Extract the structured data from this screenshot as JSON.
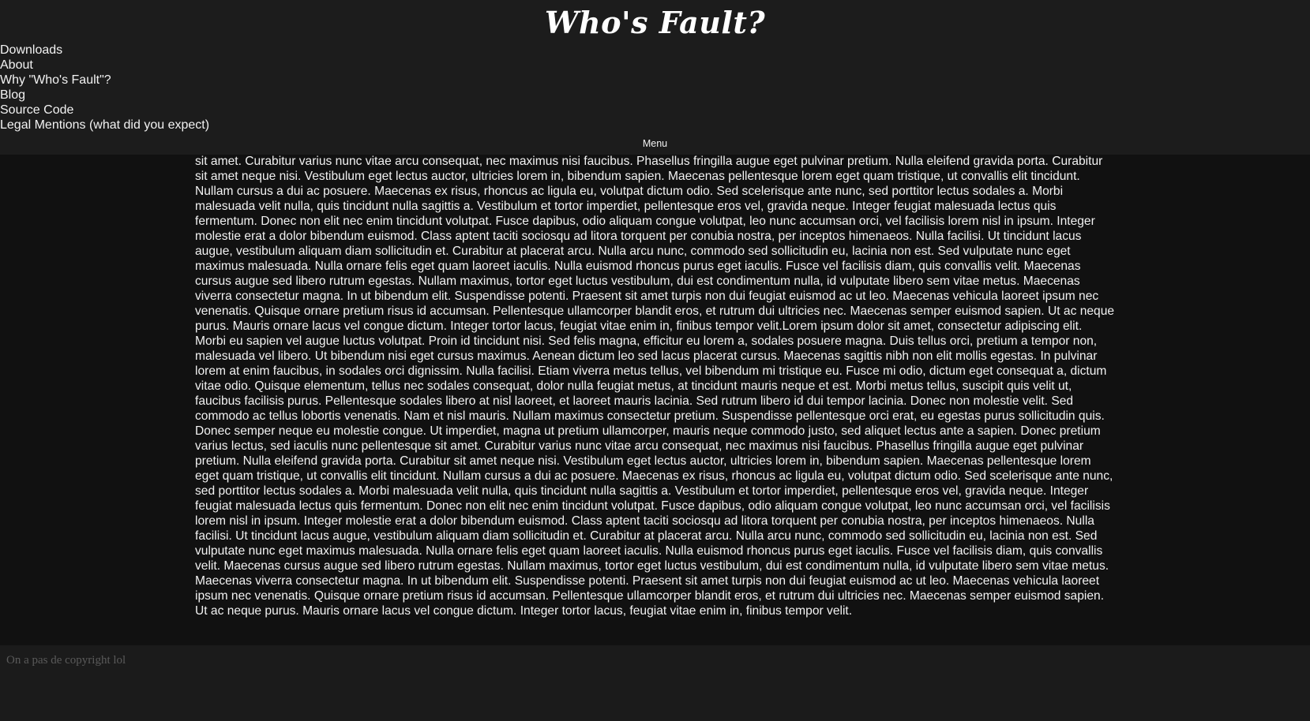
{
  "site": {
    "title": "Who's Fault?"
  },
  "nav": {
    "items": [
      {
        "label": "Downloads"
      },
      {
        "label": "About"
      },
      {
        "label": "Why \"Who's Fault\"?"
      },
      {
        "label": "Blog"
      },
      {
        "label": "Source Code"
      },
      {
        "label": "Legal Mentions (what did you expect)"
      }
    ],
    "menu_label": "Menu"
  },
  "main": {
    "body_text": "Ut imperdiet, magna ut pretium ullamcorper, mauris neque commodo justo, sed aliquet lectus ante a sapien. Donec pretium varius lectus, sed iaculis nunc pellentesque sit amet. Curabitur varius nunc vitae arcu consequat, nec maximus nisi faucibus. Phasellus fringilla augue eget pulvinar pretium. Nulla eleifend gravida porta. Curabitur sit amet neque nisi. Vestibulum eget lectus auctor, ultricies lorem in, bibendum sapien. Maecenas pellentesque lorem eget quam tristique, ut convallis elit tincidunt. Nullam cursus a dui ac posuere. Maecenas ex risus, rhoncus ac ligula eu, volutpat dictum odio. Sed scelerisque ante nunc, sed porttitor lectus sodales a. Morbi malesuada velit nulla, quis tincidunt nulla sagittis a. Vestibulum et tortor imperdiet, pellentesque eros vel, gravida neque. Integer feugiat malesuada lectus quis fermentum. Donec non elit nec enim tincidunt volutpat. Fusce dapibus, odio aliquam congue volutpat, leo nunc accumsan orci, vel facilisis lorem nisl in ipsum. Integer molestie erat a dolor bibendum euismod. Class aptent taciti sociosqu ad litora torquent per conubia nostra, per inceptos himenaeos. Nulla facilisi. Ut tincidunt lacus augue, vestibulum aliquam diam sollicitudin et. Curabitur at placerat arcu. Nulla arcu nunc, commodo sed sollicitudin eu, lacinia non est. Sed vulputate nunc eget maximus malesuada. Nulla ornare felis eget quam laoreet iaculis. Nulla euismod rhoncus purus eget iaculis. Fusce vel facilisis diam, quis convallis velit. Maecenas cursus augue sed libero rutrum egestas. Nullam maximus, tortor eget luctus vestibulum, dui est condimentum nulla, id vulputate libero sem vitae metus. Maecenas viverra consectetur magna. In ut bibendum elit. Suspendisse potenti. Praesent sit amet turpis non dui feugiat euismod ac ut leo. Maecenas vehicula laoreet ipsum nec venenatis. Quisque ornare pretium risus id accumsan. Pellentesque ullamcorper blandit eros, et rutrum dui ultricies nec. Maecenas semper euismod sapien. Ut ac neque purus. Mauris ornare lacus vel congue dictum. Integer tortor lacus, feugiat vitae enim in, finibus tempor velit.Lorem ipsum dolor sit amet, consectetur adipiscing elit. Morbi eu sapien vel augue luctus volutpat. Proin id tincidunt nisi. Sed felis magna, efficitur eu lorem a, sodales posuere magna. Duis tellus orci, pretium a tempor non, malesuada vel libero. Ut bibendum nisi eget cursus maximus. Aenean dictum leo sed lacus placerat cursus. Maecenas sagittis nibh non elit mollis egestas. In pulvinar lorem at enim faucibus, in sodales orci dignissim. Nulla facilisi. Etiam viverra metus tellus, vel bibendum mi tristique eu. Fusce mi odio, dictum eget consequat a, dictum vitae odio. Quisque elementum, tellus nec sodales consequat, dolor nulla feugiat metus, at tincidunt mauris neque et est. Morbi metus tellus, suscipit quis velit ut, faucibus facilisis purus. Pellentesque sodales libero at nisl laoreet, et laoreet mauris lacinia. Sed rutrum libero id dui tempor lacinia. Donec non molestie velit. Sed commodo ac tellus lobortis venenatis. Nam et nisl mauris. Nullam maximus consectetur pretium. Suspendisse pellentesque orci erat, eu egestas purus sollicitudin quis. Donec semper neque eu molestie congue. Ut imperdiet, magna ut pretium ullamcorper, mauris neque commodo justo, sed aliquet lectus ante a sapien. Donec pretium varius lectus, sed iaculis nunc pellentesque sit amet. Curabitur varius nunc vitae arcu consequat, nec maximus nisi faucibus. Phasellus fringilla augue eget pulvinar pretium. Nulla eleifend gravida porta. Curabitur sit amet neque nisi. Vestibulum eget lectus auctor, ultricies lorem in, bibendum sapien. Maecenas pellentesque lorem eget quam tristique, ut convallis elit tincidunt. Nullam cursus a dui ac posuere. Maecenas ex risus, rhoncus ac ligula eu, volutpat dictum odio. Sed scelerisque ante nunc, sed porttitor lectus sodales a. Morbi malesuada velit nulla, quis tincidunt nulla sagittis a. Vestibulum et tortor imperdiet, pellentesque eros vel, gravida neque. Integer feugiat malesuada lectus quis fermentum. Donec non elit nec enim tincidunt volutpat. Fusce dapibus, odio aliquam congue volutpat, leo nunc accumsan orci, vel facilisis lorem nisl in ipsum. Integer molestie erat a dolor bibendum euismod. Class aptent taciti sociosqu ad litora torquent per conubia nostra, per inceptos himenaeos. Nulla facilisi. Ut tincidunt lacus augue, vestibulum aliquam diam sollicitudin et. Curabitur at placerat arcu. Nulla arcu nunc, commodo sed sollicitudin eu, lacinia non est. Sed vulputate nunc eget maximus malesuada. Nulla ornare felis eget quam laoreet iaculis. Nulla euismod rhoncus purus eget iaculis. Fusce vel facilisis diam, quis convallis velit. Maecenas cursus augue sed libero rutrum egestas. Nullam maximus, tortor eget luctus vestibulum, dui est condimentum nulla, id vulputate libero sem vitae metus. Maecenas viverra consectetur magna. In ut bibendum elit. Suspendisse potenti. Praesent sit amet turpis non dui feugiat euismod ac ut leo. Maecenas vehicula laoreet ipsum nec venenatis. Quisque ornare pretium risus id accumsan. Pellentesque ullamcorper blandit eros, et rutrum dui ultricies nec. Maecenas semper euismod sapien. Ut ac neque purus. Mauris ornare lacus vel congue dictum. Integer tortor lacus, feugiat vitae enim in, finibus tempor velit."
  },
  "footer": {
    "text": "On a pas de copyright lol"
  },
  "colors": {
    "header_bg": "#1c1c1c",
    "content_bg": "#111111",
    "footer_bg": "#1b1b1b",
    "text": "#f2f2f2",
    "footer_text": "#5a5a5a"
  }
}
